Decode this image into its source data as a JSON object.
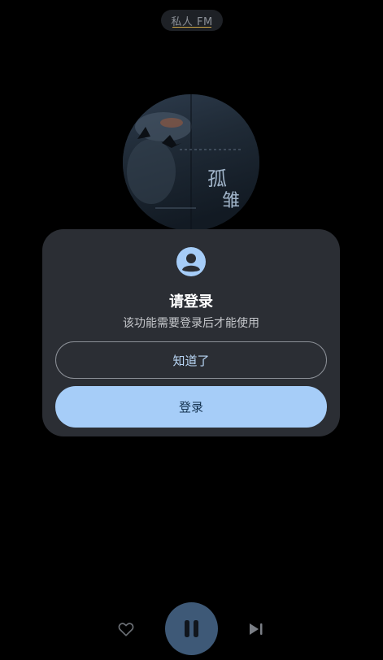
{
  "header": {
    "title": "私人 FM"
  },
  "dialog": {
    "title": "请登录",
    "description": "该功能需要登录后才能使用",
    "dismiss_label": "知道了",
    "login_label": "登录"
  },
  "album": {
    "art_lettering": "孤 雏"
  },
  "controls": {
    "like_icon": "heart-outline-icon",
    "pause_icon": "pause-icon",
    "next_icon": "skip-next-icon"
  },
  "colors": {
    "background": "#000000",
    "dialog_bg": "#2b2e34",
    "accent": "#a6cdf8",
    "play_button": "#3e5977"
  }
}
